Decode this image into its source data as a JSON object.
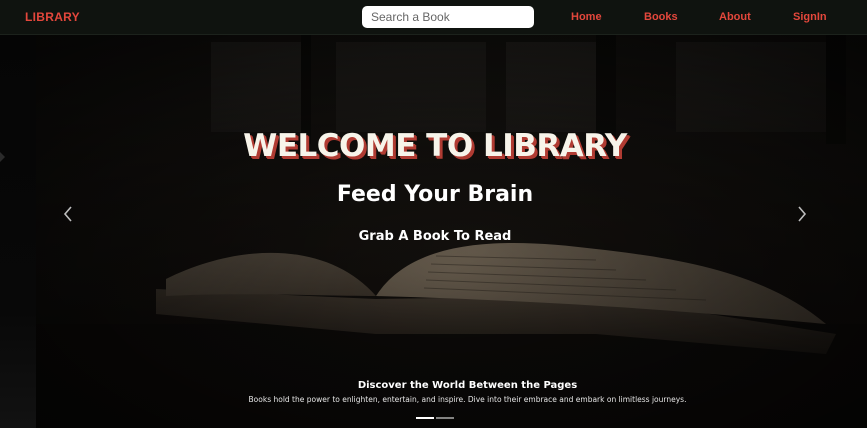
{
  "navbar": {
    "brand": "LIBRARY",
    "search_placeholder": "Search a Book",
    "links": [
      "Home",
      "Books",
      "About",
      "SignIn"
    ]
  },
  "carousel": {
    "title": "WELCOME TO LIBRARY",
    "subtitle": "Feed Your Brain",
    "tagline": "Grab A Book To Read",
    "caption_title": "Discover the World Between the Pages",
    "caption_text": "Books hold the power to enlighten, entertain, and inspire. Dive into their embrace and embark on limitless journeys.",
    "slide_count": 2,
    "active_slide": 1
  },
  "icons": {
    "prev": "chevron-left-icon",
    "next": "chevron-right-icon"
  },
  "colors": {
    "brand_accent": "#e4473c",
    "navbar_bg": "#0f130f",
    "title_shadow": "#b03b32",
    "hero_text": "#ffffff"
  }
}
